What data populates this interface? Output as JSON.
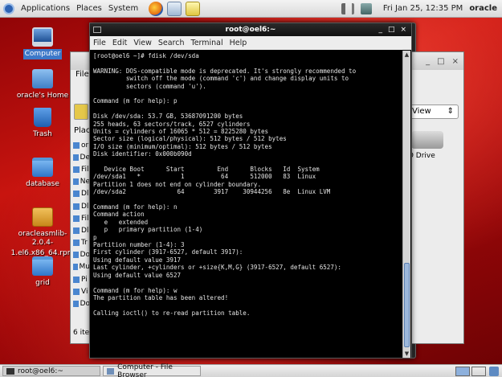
{
  "top_panel": {
    "menus": [
      "Applications",
      "Places",
      "System"
    ],
    "launchers": [
      "firefox-icon",
      "mail-icon",
      "text-editor-icon",
      "terminal-icon"
    ],
    "clock": "Fri Jan 25, 12:35 PM",
    "user": "oracle"
  },
  "desktop_icons": [
    {
      "label": "Computer",
      "icon": "computer-icon",
      "selected": true
    },
    {
      "label": "oracle's Home",
      "icon": "home-folder-icon"
    },
    {
      "label": "Trash",
      "icon": "trash-icon"
    },
    {
      "label": "database",
      "icon": "folder-icon"
    },
    {
      "label": "oracleasmlib-2.0.4-1.el6.x86_64.rpm",
      "label_line1": "oracleasmlib-2.0.4-",
      "label_line2": "1.el6.x86_64.rpm",
      "icon": "package-icon"
    },
    {
      "label": "grid",
      "icon": "folder-icon"
    }
  ],
  "file_browser": {
    "menu_first": "File",
    "places_header": "Plac",
    "places": [
      "or",
      "De",
      "Fil",
      "Ne",
      "Dl",
      "Dl",
      "Fil",
      "Dl",
      "Tr",
      "Do",
      "Mu",
      "Pi",
      "Vi",
      "Do"
    ],
    "view_select": "View",
    "drive_label": "D Drive",
    "items_count": "6 iter",
    "window_controls": [
      "_",
      "□",
      "×"
    ]
  },
  "terminal": {
    "title": "root@oel6:~",
    "window_controls": [
      "_",
      "□",
      "×"
    ],
    "menu": [
      "File",
      "Edit",
      "View",
      "Search",
      "Terminal",
      "Help"
    ],
    "lines": [
      "[root@oel6 ~]# fdisk /dev/sda",
      "",
      "WARNING: DOS-compatible mode is deprecated. It's strongly recommended to",
      "         switch off the mode (command 'c') and change display units to",
      "         sectors (command 'u').",
      "",
      "Command (m for help): p",
      "",
      "Disk /dev/sda: 53.7 GB, 53687091200 bytes",
      "255 heads, 63 sectors/track, 6527 cylinders",
      "Units = cylinders of 16065 * 512 = 8225280 bytes",
      "Sector size (logical/physical): 512 bytes / 512 bytes",
      "I/O size (minimum/optimal): 512 bytes / 512 bytes",
      "Disk identifier: 0x000b090d",
      "",
      "   Device Boot      Start         End      Blocks   Id  System",
      "/dev/sda1   *           1          64      512000   83  Linux",
      "Partition 1 does not end on cylinder boundary.",
      "/dev/sda2              64        3917    30944256   8e  Linux LVM",
      "",
      "Command (m for help): n",
      "Command action",
      "   e   extended",
      "   p   primary partition (1-4)",
      "p",
      "Partition number (1-4): 3",
      "First cylinder (3917-6527, default 3917):",
      "Using default value 3917",
      "Last cylinder, +cylinders or +size{K,M,G} (3917-6527, default 6527):",
      "Using default value 6527",
      "",
      "Command (m for help): w",
      "The partition table has been altered!",
      "",
      "Calling ioctl() to re-read partition table."
    ]
  },
  "taskbar": {
    "items": [
      {
        "label": "root@oel6:~",
        "icon": "terminal-icon"
      },
      {
        "label": "Computer - File Browser",
        "icon": "file-browser-icon"
      }
    ]
  }
}
